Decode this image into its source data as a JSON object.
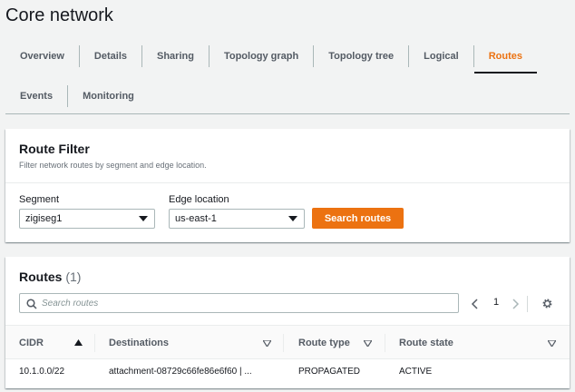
{
  "page": {
    "title": "Core network"
  },
  "tabs": [
    {
      "label": "Overview",
      "active": false
    },
    {
      "label": "Details",
      "active": false
    },
    {
      "label": "Sharing",
      "active": false
    },
    {
      "label": "Topology graph",
      "active": false
    },
    {
      "label": "Topology tree",
      "active": false
    },
    {
      "label": "Logical",
      "active": false
    },
    {
      "label": "Routes",
      "active": true
    },
    {
      "label": "Events",
      "active": false
    },
    {
      "label": "Monitoring",
      "active": false
    }
  ],
  "filter": {
    "title": "Route Filter",
    "description": "Filter network routes by segment and edge location.",
    "segment_label": "Segment",
    "segment_value": "zigiseg1",
    "edge_label": "Edge location",
    "edge_value": "us-east-1",
    "search_button": "Search routes"
  },
  "routes": {
    "title": "Routes",
    "count": "(1)",
    "search_placeholder": "Search routes",
    "page": "1",
    "columns": [
      "CIDR",
      "Destinations",
      "Route type",
      "Route state"
    ],
    "rows": [
      {
        "cidr": "10.1.0.0/22",
        "destinations": "attachment-08729c66fe86e6f60 | ...",
        "route_type": "PROPAGATED",
        "route_state": "ACTIVE"
      }
    ]
  },
  "colors": {
    "accent": "#ec7211",
    "text": "#16191f",
    "muted": "#545b64",
    "background": "#f2f3f3"
  }
}
